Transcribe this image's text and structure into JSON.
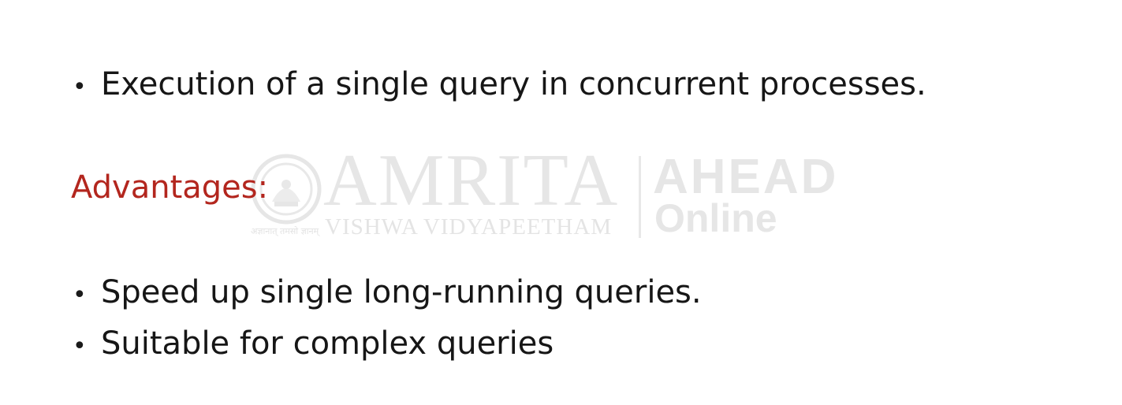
{
  "slide": {
    "intro_bullet": "Execution of a single query in concurrent processes.",
    "heading": "Advantages:",
    "advantages": [
      "Speed up single long-running queries.",
      "Suitable for complex queries"
    ],
    "bullet_glyph": "•"
  },
  "watermark": {
    "brand": "AMRITA",
    "subtitle": "VISHWA VIDYAPEETHAM",
    "product_top": "AHEAD",
    "product_bottom": "Online",
    "seal_motto": "अज्ञानात् तमसो ज्ञानम्"
  },
  "colors": {
    "heading": "#b3261e",
    "text": "#161616",
    "watermark": "#e6e6e6",
    "background": "#ffffff"
  }
}
